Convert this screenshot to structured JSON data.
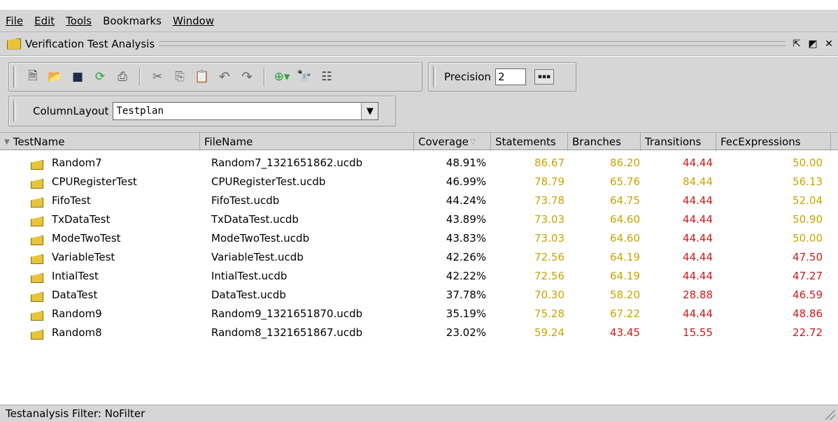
{
  "colors": {
    "yellow_value": "#c9a400",
    "red_value": "#cc1a1a",
    "black_value": "#000000"
  },
  "menu": [
    "File",
    "Edit",
    "Tools",
    "Bookmarks",
    "Window"
  ],
  "window": {
    "title": "Verification Test Analysis"
  },
  "toolbar": {
    "icons": [
      "new-document-icon",
      "open-folder-icon",
      "save-icon",
      "refresh-icon",
      "print-icon",
      "cut-icon",
      "copy-icon",
      "paste-icon",
      "undo-icon",
      "redo-icon",
      "add-icon",
      "find-icon",
      "columns-icon"
    ],
    "precision_label": "Precision",
    "precision_value": "2",
    "column_layout_label": "ColumnLayout",
    "column_layout_value": "Testplan"
  },
  "table": {
    "columns": [
      "TestName",
      "FileName",
      "Coverage",
      "Statements",
      "Branches",
      "Transitions",
      "FecExpressions"
    ],
    "rows": [
      {
        "test": "Random7",
        "file": "Random7_1321651862.ucdb",
        "coverage": "48.91%",
        "statements": "86.67",
        "statements_color": "yellow",
        "branches": "86.20",
        "branches_color": "yellow",
        "transitions": "44.44",
        "transitions_color": "red",
        "fec": "50.00",
        "fec_color": "yellow"
      },
      {
        "test": "CPURegisterTest",
        "file": "CPURegisterTest.ucdb",
        "coverage": "46.99%",
        "statements": "78.79",
        "statements_color": "yellow",
        "branches": "65.76",
        "branches_color": "yellow",
        "transitions": "84.44",
        "transitions_color": "yellow",
        "fec": "56.13",
        "fec_color": "yellow"
      },
      {
        "test": "FifoTest",
        "file": "FifoTest.ucdb",
        "coverage": "44.24%",
        "statements": "73.78",
        "statements_color": "yellow",
        "branches": "64.75",
        "branches_color": "yellow",
        "transitions": "44.44",
        "transitions_color": "red",
        "fec": "52.04",
        "fec_color": "yellow"
      },
      {
        "test": "TxDataTest",
        "file": "TxDataTest.ucdb",
        "coverage": "43.89%",
        "statements": "73.03",
        "statements_color": "yellow",
        "branches": "64.60",
        "branches_color": "yellow",
        "transitions": "44.44",
        "transitions_color": "red",
        "fec": "50.90",
        "fec_color": "yellow"
      },
      {
        "test": "ModeTwoTest",
        "file": "ModeTwoTest.ucdb",
        "coverage": "43.83%",
        "statements": "73.03",
        "statements_color": "yellow",
        "branches": "64.60",
        "branches_color": "yellow",
        "transitions": "44.44",
        "transitions_color": "red",
        "fec": "50.00",
        "fec_color": "yellow"
      },
      {
        "test": "VariableTest",
        "file": "VariableTest.ucdb",
        "coverage": "42.26%",
        "statements": "72.56",
        "statements_color": "yellow",
        "branches": "64.19",
        "branches_color": "yellow",
        "transitions": "44.44",
        "transitions_color": "red",
        "fec": "47.50",
        "fec_color": "red"
      },
      {
        "test": "IntialTest",
        "file": "IntialTest.ucdb",
        "coverage": "42.22%",
        "statements": "72.56",
        "statements_color": "yellow",
        "branches": "64.19",
        "branches_color": "yellow",
        "transitions": "44.44",
        "transitions_color": "red",
        "fec": "47.27",
        "fec_color": "red"
      },
      {
        "test": "DataTest",
        "file": "DataTest.ucdb",
        "coverage": "37.78%",
        "statements": "70.30",
        "statements_color": "yellow",
        "branches": "58.20",
        "branches_color": "yellow",
        "transitions": "28.88",
        "transitions_color": "red",
        "fec": "46.59",
        "fec_color": "red"
      },
      {
        "test": "Random9",
        "file": "Random9_1321651870.ucdb",
        "coverage": "35.19%",
        "statements": "75.28",
        "statements_color": "yellow",
        "branches": "67.22",
        "branches_color": "yellow",
        "transitions": "44.44",
        "transitions_color": "red",
        "fec": "48.86",
        "fec_color": "red"
      },
      {
        "test": "Random8",
        "file": "Random8_1321651867.ucdb",
        "coverage": "23.02%",
        "statements": "59.24",
        "statements_color": "yellow",
        "branches": "43.45",
        "branches_color": "red",
        "transitions": "15.55",
        "transitions_color": "red",
        "fec": "22.72",
        "fec_color": "red"
      }
    ]
  },
  "status": {
    "text": "Testanalysis Filter: NoFilter"
  }
}
